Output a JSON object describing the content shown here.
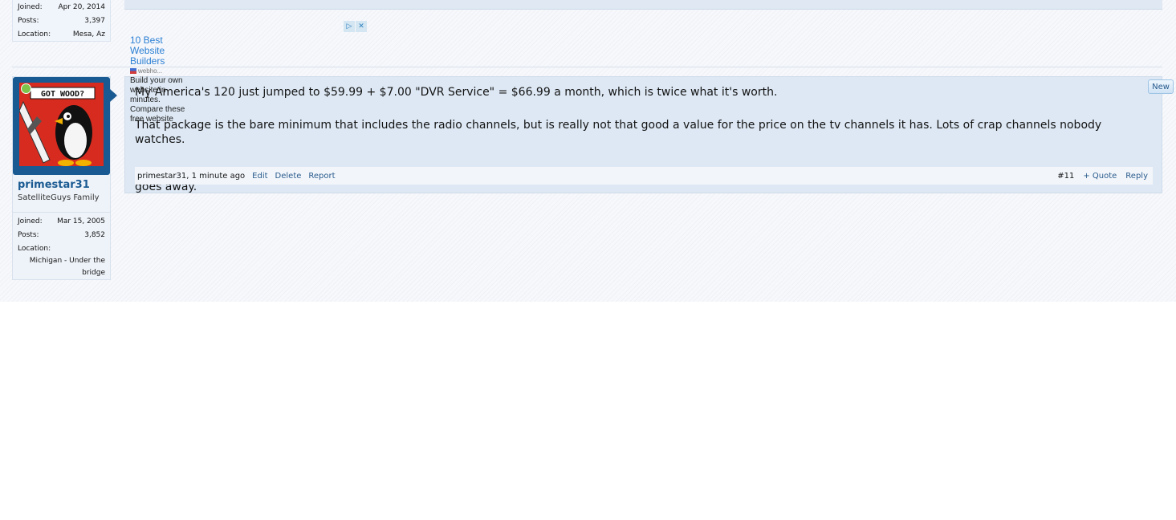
{
  "previous_post": {
    "joined_label": "Joined:",
    "joined_value": "Apr 20, 2014",
    "posts_label": "Posts:",
    "posts_value": "3,397",
    "location_label": "Location:",
    "location_value": "Mesa, Az"
  },
  "ad": {
    "adchoices_icon": "adchoices-icon",
    "close_icon": "close-icon",
    "title": "10 Best Website Builders",
    "source": "webho...",
    "description": "Build your own website in minutes. Compare these free website"
  },
  "post": {
    "username": "primestar31",
    "user_title": "SatelliteGuys Family",
    "joined_label": "Joined:",
    "joined_value": "Mar 15, 2005",
    "posts_label": "Posts:",
    "posts_value": "3,852",
    "location_label": "Location:",
    "location_value": "Michigan - Under the bridge",
    "avatar_text": "GOT WOOD?",
    "paragraphs": [
      "My America's 120 just jumped to $59.99 + $7.00 \"DVR Service\" = $66.99 a month, which is twice what it's worth.",
      "That package is the bare minimum that includes the radio channels, but is really not that good a value for the price on the tv channels it has. Lots of crap channels nobody watches.",
      "My next move will be a Tivo Roamio, running OTA channels, and some streaming, and including FTA satellite. I plan on installing better outside tv antennas as soon as the snow goes away."
    ],
    "meta": "primestar31, 1 minute ago",
    "edit_label": "Edit",
    "delete_label": "Delete",
    "report_label": "Report",
    "post_number": "#11",
    "quote_label": "+ Quote",
    "reply_label": "Reply",
    "new_badge": "New"
  },
  "colors": {
    "username": "#1a5a92",
    "message_bg": "#dde8f4",
    "avatar_bg": "#d82b1f",
    "online": "#7dc34a"
  }
}
